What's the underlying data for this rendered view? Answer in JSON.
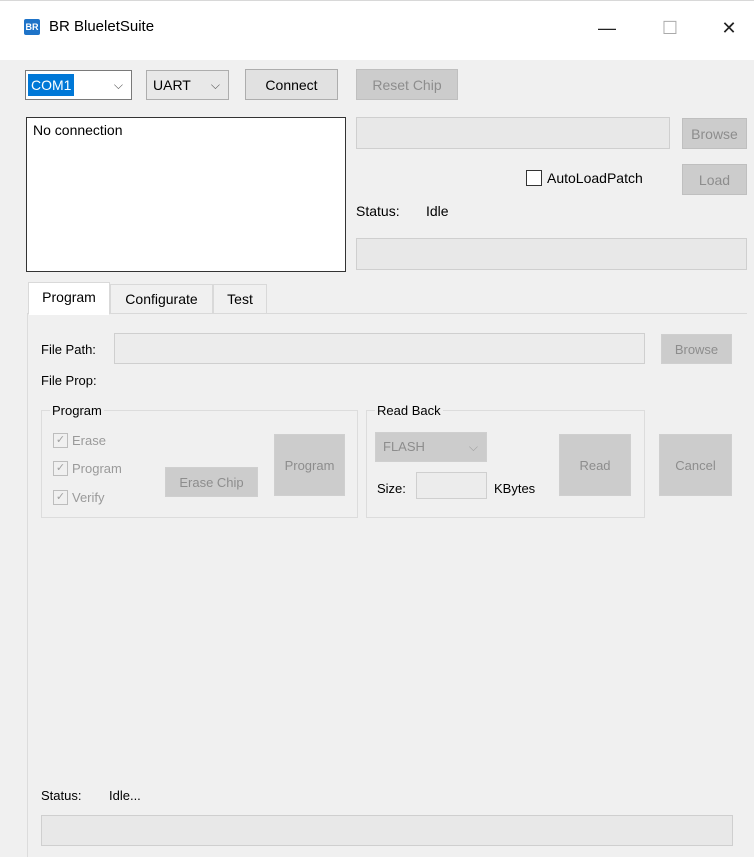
{
  "window": {
    "title": "BR BlueletSuite",
    "icon_text": "BR",
    "minimize_glyph": "—",
    "maximize_glyph": "☐",
    "close_glyph": "✕"
  },
  "toolbar": {
    "com_port": "COM1",
    "interface": "UART",
    "connect_label": "Connect",
    "reset_chip_label": "Reset Chip"
  },
  "connection_log": "No connection",
  "patch": {
    "browse_label": "Browse",
    "autoload_label": "AutoLoadPatch",
    "autoload_checked": false,
    "load_label": "Load",
    "status_label": "Status:",
    "status_value": "Idle"
  },
  "tabs": [
    {
      "label": "Program",
      "active": true
    },
    {
      "label": "Configurate",
      "active": false
    },
    {
      "label": "Test",
      "active": false
    }
  ],
  "program_tab": {
    "file_path_label": "File Path:",
    "browse_label": "Browse",
    "file_prop_label": "File Prop:",
    "program_group": {
      "title": "Program",
      "options": [
        {
          "label": "Erase",
          "checked": true
        },
        {
          "label": "Program",
          "checked": true
        },
        {
          "label": "Verify",
          "checked": true
        }
      ],
      "erase_chip_label": "Erase Chip",
      "program_label": "Program"
    },
    "read_back_group": {
      "title": "Read Back",
      "memory": "FLASH",
      "size_label": "Size:",
      "size_unit": "KBytes",
      "read_label": "Read"
    },
    "cancel_label": "Cancel"
  },
  "footer": {
    "status_label": "Status:",
    "status_value": "Idle..."
  },
  "icons": {
    "checkmark": "✓",
    "chevron": "⌵"
  }
}
